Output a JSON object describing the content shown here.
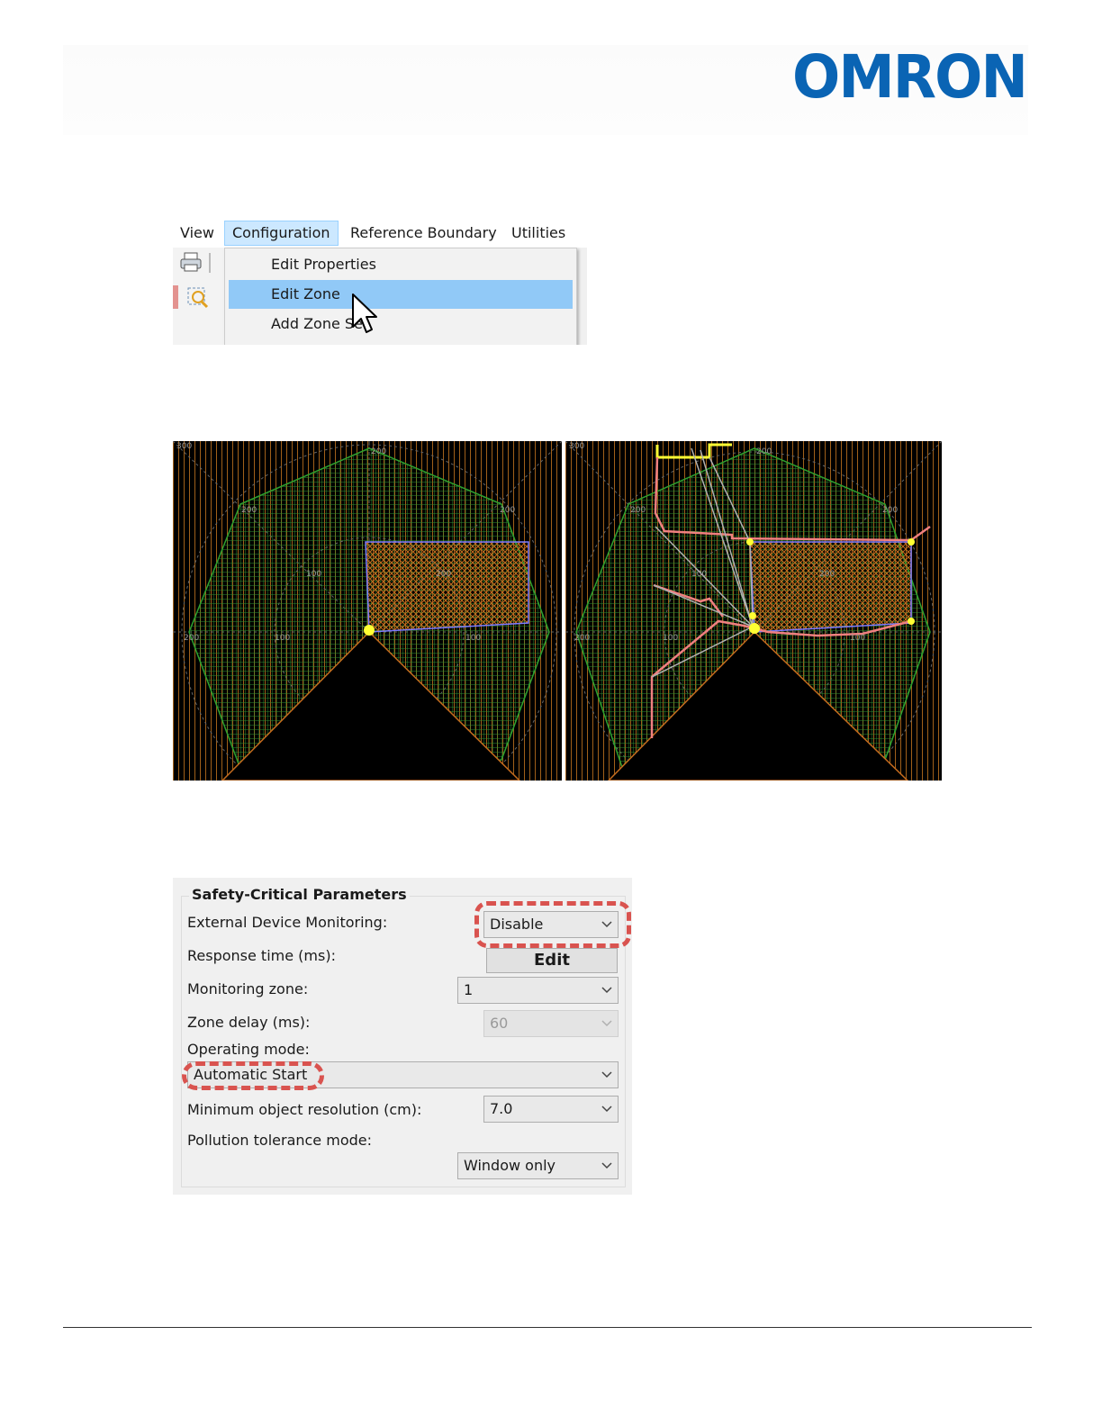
{
  "brand": {
    "logo_text": "OMRON",
    "logo_color": "#0a64b4"
  },
  "menu": {
    "bar_items": [
      "View",
      "Configuration",
      "Reference Boundary",
      "Utilities"
    ],
    "active_item": "Configuration",
    "dropdown_items": [
      "Edit Properties",
      "Edit Zone",
      "Add Zone Set"
    ],
    "highlighted_item": "Edit Zone",
    "highlight_color": "#91c9f7"
  },
  "radar_views": {
    "left": {
      "tick_labels": [
        "300",
        "200",
        "200",
        "200",
        "100",
        "200",
        "100",
        "100",
        "200"
      ]
    },
    "right": {
      "tick_labels": [
        "300",
        "200",
        "200",
        "200",
        "100",
        "200",
        "100",
        "100",
        "200"
      ]
    },
    "colors": {
      "grid": "#c67a1e",
      "zone": "#2ea02e",
      "warning_field": "#b05a18",
      "outline": "#7b7bff",
      "points": "#ffff33",
      "contour": "#f08080"
    }
  },
  "safety_panel": {
    "title": "Safety-Critical Parameters",
    "edm_label": "External Device Monitoring:",
    "edm_value": "Disable",
    "response_label": "Response time (ms):",
    "response_button": "Edit",
    "monitoring_label": "Monitoring zone:",
    "monitoring_value": "1",
    "delay_label": "Zone delay (ms):",
    "delay_value": "60",
    "operating_label": "Operating mode:",
    "operating_value": "Automatic Start",
    "resolution_label": "Minimum object resolution (cm):",
    "resolution_value": "7.0",
    "pollution_label": "Pollution tolerance mode:",
    "pollution_value": "Window only",
    "callout_color": "#d9534f"
  }
}
